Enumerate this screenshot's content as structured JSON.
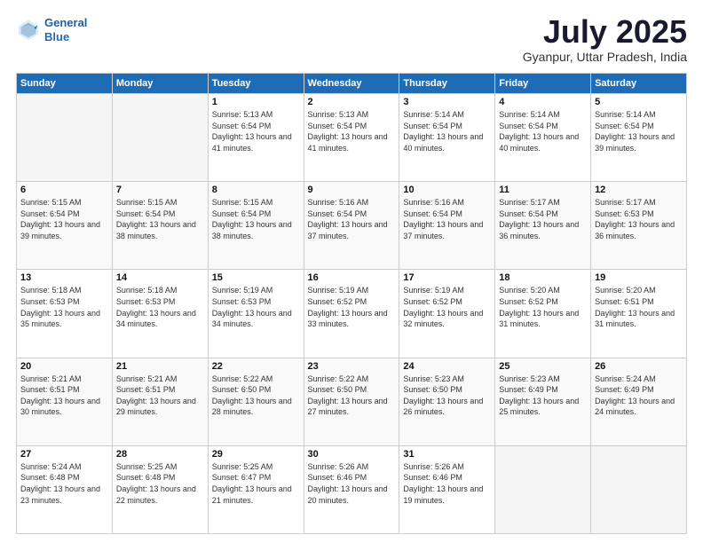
{
  "header": {
    "logo_line1": "General",
    "logo_line2": "Blue",
    "month": "July 2025",
    "location": "Gyanpur, Uttar Pradesh, India"
  },
  "days_of_week": [
    "Sunday",
    "Monday",
    "Tuesday",
    "Wednesday",
    "Thursday",
    "Friday",
    "Saturday"
  ],
  "weeks": [
    [
      {
        "day": "",
        "info": ""
      },
      {
        "day": "",
        "info": ""
      },
      {
        "day": "1",
        "info": "Sunrise: 5:13 AM\nSunset: 6:54 PM\nDaylight: 13 hours and 41 minutes."
      },
      {
        "day": "2",
        "info": "Sunrise: 5:13 AM\nSunset: 6:54 PM\nDaylight: 13 hours and 41 minutes."
      },
      {
        "day": "3",
        "info": "Sunrise: 5:14 AM\nSunset: 6:54 PM\nDaylight: 13 hours and 40 minutes."
      },
      {
        "day": "4",
        "info": "Sunrise: 5:14 AM\nSunset: 6:54 PM\nDaylight: 13 hours and 40 minutes."
      },
      {
        "day": "5",
        "info": "Sunrise: 5:14 AM\nSunset: 6:54 PM\nDaylight: 13 hours and 39 minutes."
      }
    ],
    [
      {
        "day": "6",
        "info": "Sunrise: 5:15 AM\nSunset: 6:54 PM\nDaylight: 13 hours and 39 minutes."
      },
      {
        "day": "7",
        "info": "Sunrise: 5:15 AM\nSunset: 6:54 PM\nDaylight: 13 hours and 38 minutes."
      },
      {
        "day": "8",
        "info": "Sunrise: 5:15 AM\nSunset: 6:54 PM\nDaylight: 13 hours and 38 minutes."
      },
      {
        "day": "9",
        "info": "Sunrise: 5:16 AM\nSunset: 6:54 PM\nDaylight: 13 hours and 37 minutes."
      },
      {
        "day": "10",
        "info": "Sunrise: 5:16 AM\nSunset: 6:54 PM\nDaylight: 13 hours and 37 minutes."
      },
      {
        "day": "11",
        "info": "Sunrise: 5:17 AM\nSunset: 6:54 PM\nDaylight: 13 hours and 36 minutes."
      },
      {
        "day": "12",
        "info": "Sunrise: 5:17 AM\nSunset: 6:53 PM\nDaylight: 13 hours and 36 minutes."
      }
    ],
    [
      {
        "day": "13",
        "info": "Sunrise: 5:18 AM\nSunset: 6:53 PM\nDaylight: 13 hours and 35 minutes."
      },
      {
        "day": "14",
        "info": "Sunrise: 5:18 AM\nSunset: 6:53 PM\nDaylight: 13 hours and 34 minutes."
      },
      {
        "day": "15",
        "info": "Sunrise: 5:19 AM\nSunset: 6:53 PM\nDaylight: 13 hours and 34 minutes."
      },
      {
        "day": "16",
        "info": "Sunrise: 5:19 AM\nSunset: 6:52 PM\nDaylight: 13 hours and 33 minutes."
      },
      {
        "day": "17",
        "info": "Sunrise: 5:19 AM\nSunset: 6:52 PM\nDaylight: 13 hours and 32 minutes."
      },
      {
        "day": "18",
        "info": "Sunrise: 5:20 AM\nSunset: 6:52 PM\nDaylight: 13 hours and 31 minutes."
      },
      {
        "day": "19",
        "info": "Sunrise: 5:20 AM\nSunset: 6:51 PM\nDaylight: 13 hours and 31 minutes."
      }
    ],
    [
      {
        "day": "20",
        "info": "Sunrise: 5:21 AM\nSunset: 6:51 PM\nDaylight: 13 hours and 30 minutes."
      },
      {
        "day": "21",
        "info": "Sunrise: 5:21 AM\nSunset: 6:51 PM\nDaylight: 13 hours and 29 minutes."
      },
      {
        "day": "22",
        "info": "Sunrise: 5:22 AM\nSunset: 6:50 PM\nDaylight: 13 hours and 28 minutes."
      },
      {
        "day": "23",
        "info": "Sunrise: 5:22 AM\nSunset: 6:50 PM\nDaylight: 13 hours and 27 minutes."
      },
      {
        "day": "24",
        "info": "Sunrise: 5:23 AM\nSunset: 6:50 PM\nDaylight: 13 hours and 26 minutes."
      },
      {
        "day": "25",
        "info": "Sunrise: 5:23 AM\nSunset: 6:49 PM\nDaylight: 13 hours and 25 minutes."
      },
      {
        "day": "26",
        "info": "Sunrise: 5:24 AM\nSunset: 6:49 PM\nDaylight: 13 hours and 24 minutes."
      }
    ],
    [
      {
        "day": "27",
        "info": "Sunrise: 5:24 AM\nSunset: 6:48 PM\nDaylight: 13 hours and 23 minutes."
      },
      {
        "day": "28",
        "info": "Sunrise: 5:25 AM\nSunset: 6:48 PM\nDaylight: 13 hours and 22 minutes."
      },
      {
        "day": "29",
        "info": "Sunrise: 5:25 AM\nSunset: 6:47 PM\nDaylight: 13 hours and 21 minutes."
      },
      {
        "day": "30",
        "info": "Sunrise: 5:26 AM\nSunset: 6:46 PM\nDaylight: 13 hours and 20 minutes."
      },
      {
        "day": "31",
        "info": "Sunrise: 5:26 AM\nSunset: 6:46 PM\nDaylight: 13 hours and 19 minutes."
      },
      {
        "day": "",
        "info": ""
      },
      {
        "day": "",
        "info": ""
      }
    ]
  ]
}
